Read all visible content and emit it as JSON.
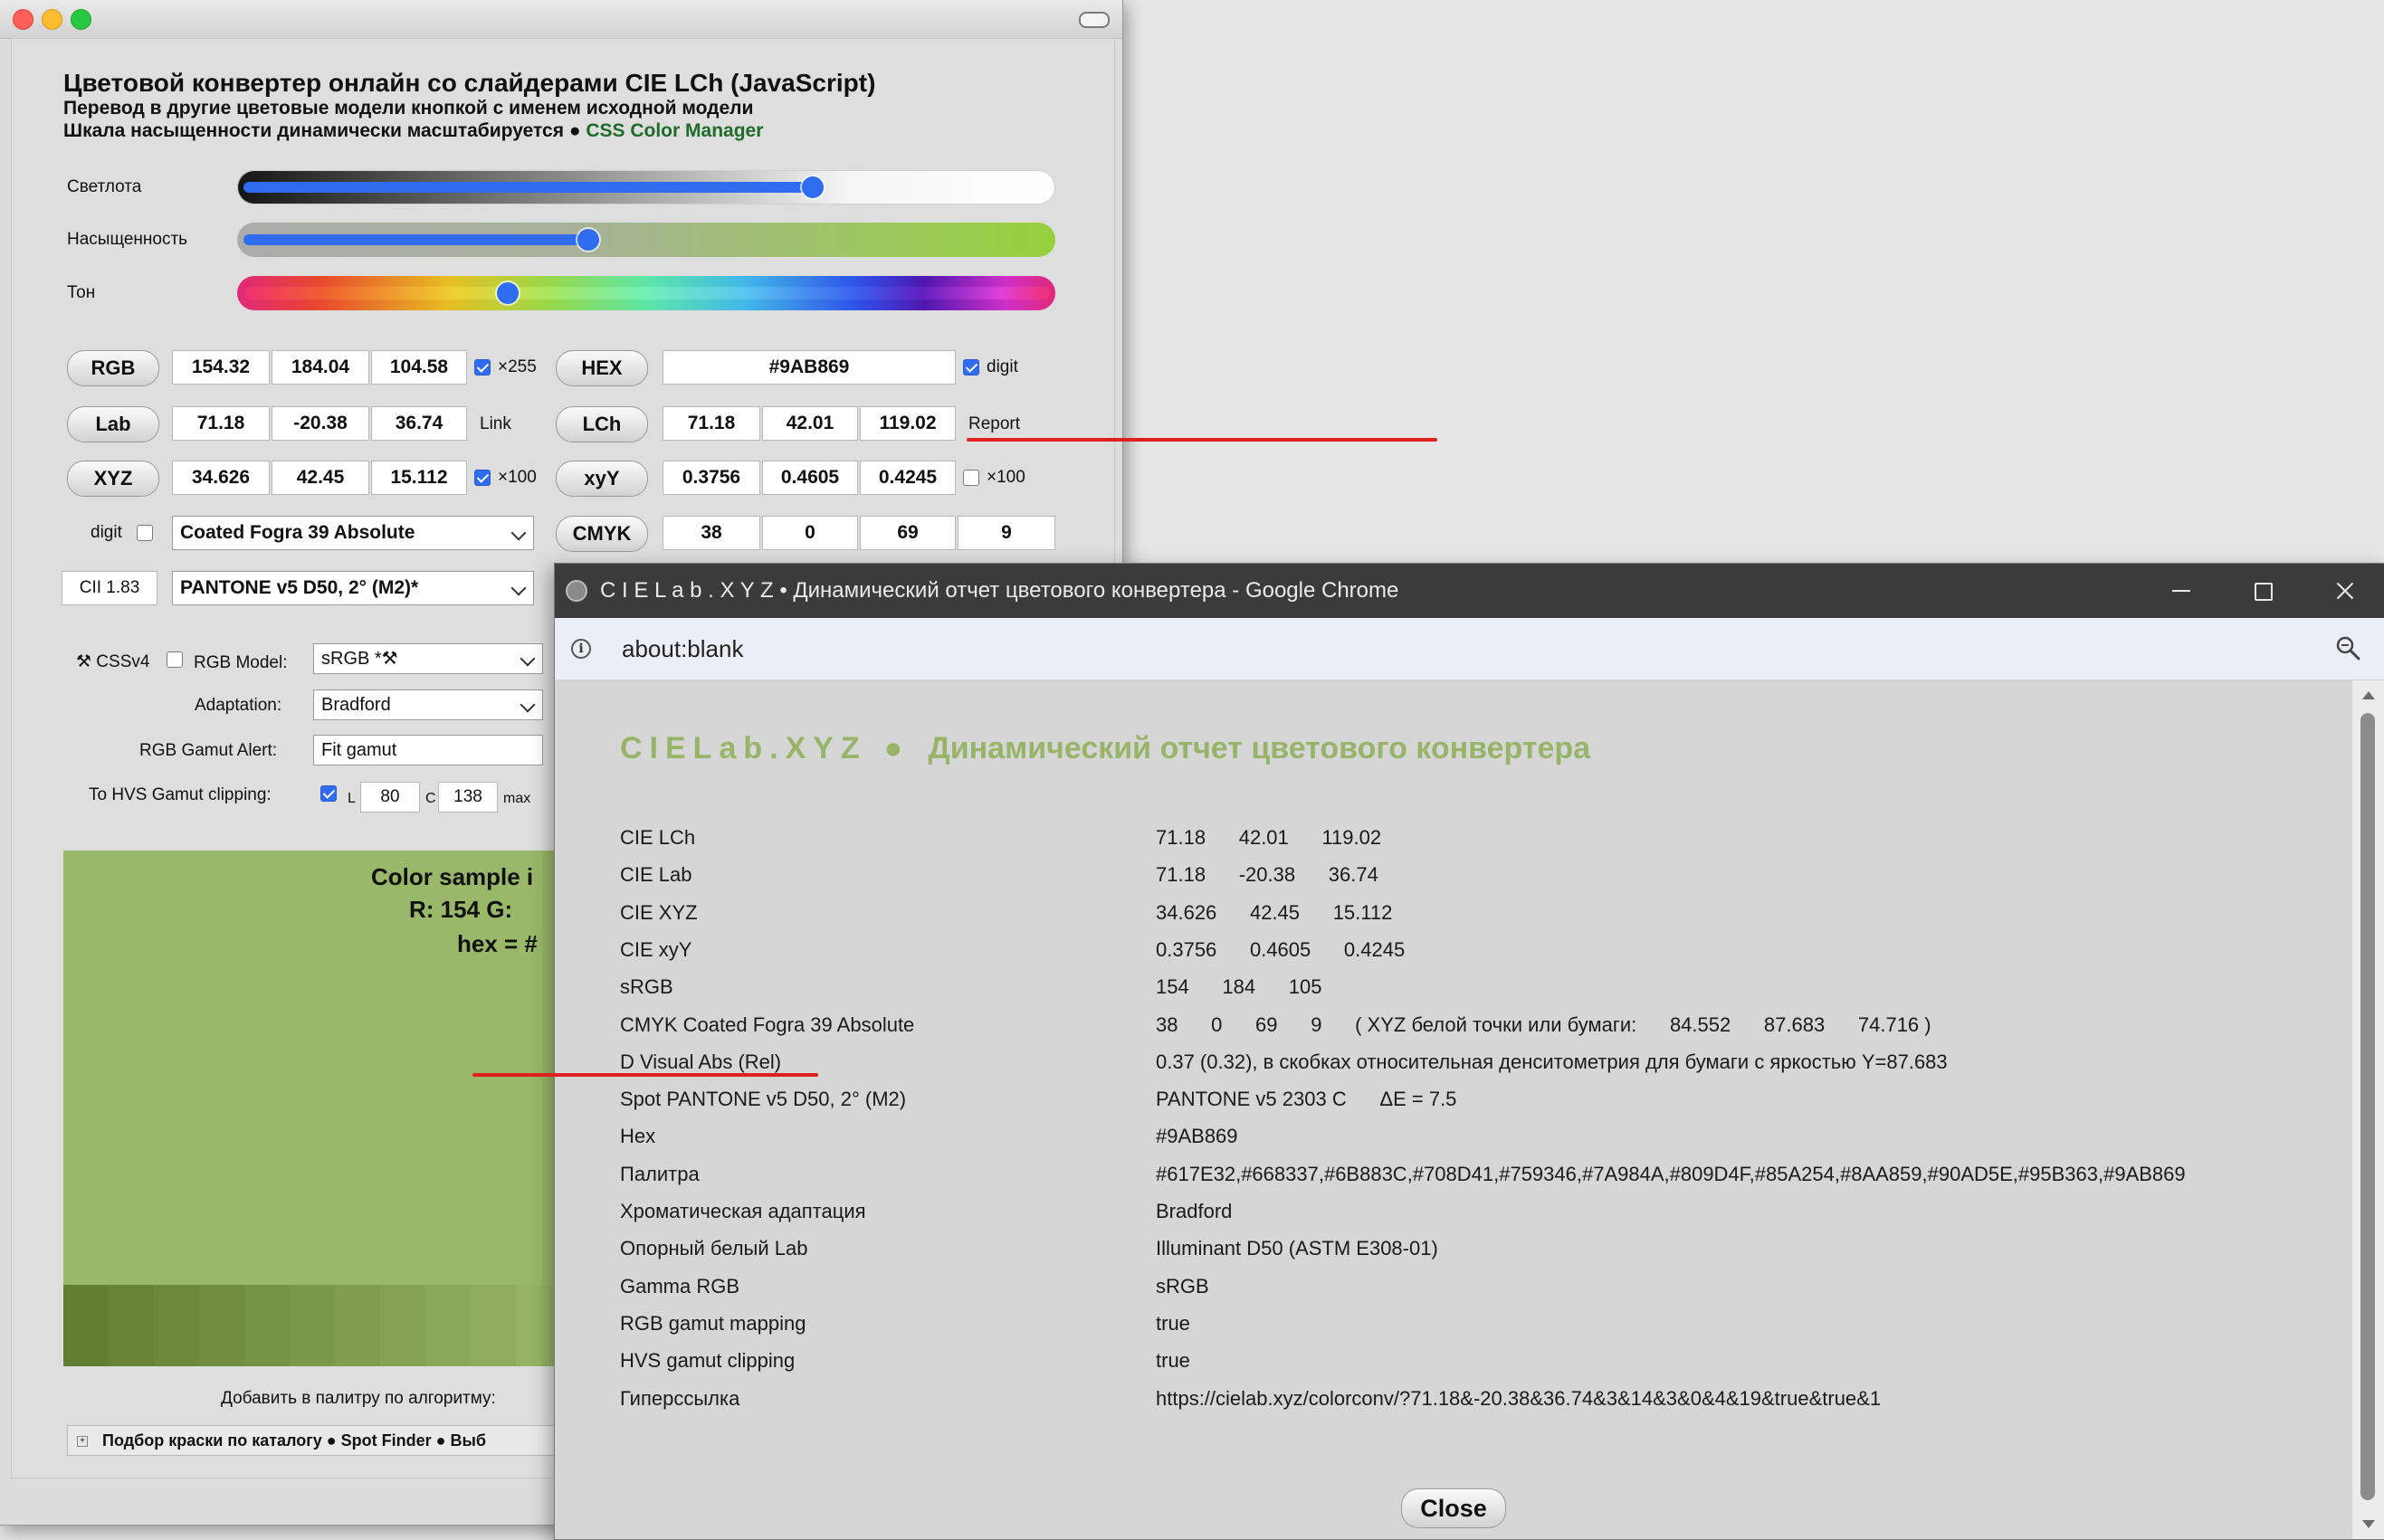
{
  "main": {
    "heading1": "Цветовой конвертер онлайн со слайдерами CIE LCh (JavaScript)",
    "heading2": "Перевод в другие цветовые модели кнопкой с именем исходной модели",
    "heading3_text": "Шкала насыщенности динамически масштабируется  ●  ",
    "heading3_link": "CSS Color Manager",
    "sliders": {
      "lightness": {
        "label": "Светлота",
        "value": 0.71
      },
      "chroma": {
        "label": "Насыщенность",
        "value": 0.43
      },
      "hue": {
        "label": "Тон",
        "value": 0.33
      }
    },
    "rows": {
      "rgb": {
        "button": "RGB",
        "v1": "154.32",
        "v2": "184.04",
        "v3": "104.58",
        "opt": "×255",
        "opt_checked": true
      },
      "hex": {
        "button": "HEX",
        "value": "#9AB869",
        "opt": "digit",
        "opt_checked": true
      },
      "lab": {
        "button": "Lab",
        "v1": "71.18",
        "v2": "-20.38",
        "v3": "36.74",
        "link": "Link"
      },
      "lch": {
        "button": "LCh",
        "v1": "71.18",
        "v2": "42.01",
        "v3": "119.02",
        "report": "Report"
      },
      "xyz": {
        "button": "XYZ",
        "v1": "34.626",
        "v2": "42.45",
        "v3": "15.112",
        "opt": "×100",
        "opt_checked": true
      },
      "xyy": {
        "button": "xyY",
        "v1": "0.3756",
        "v2": "0.4605",
        "v3": "0.4245",
        "opt": "×100",
        "opt_checked": false
      },
      "cmyk": {
        "digit_label": "digit",
        "profile": "Coated Fogra 39 Absolute",
        "button": "CMYK",
        "c": "38",
        "m": "0",
        "y": "69",
        "k": "9"
      },
      "spot": {
        "cii": "CII 1.83",
        "library": "PANTONE v5   D50, 2° (M2)*"
      }
    },
    "settings": {
      "cssv4_label": "⚒ CSSv4",
      "rgb_model_label": "RGB Model:",
      "rgb_model_value": "sRGB *⚒",
      "adaptation_label": "Adaptation:",
      "adaptation_value": "Bradford",
      "gamut_alert_label": "RGB Gamut Alert:",
      "gamut_alert_value": "Fit gamut",
      "hvs_label": "To HVS Gamut clipping:",
      "hvs_l_label": "L",
      "hvs_l_value": "80",
      "hvs_c_label": "C",
      "hvs_c_value": "138",
      "hvs_max": "max"
    },
    "sample": {
      "color": "#9AB869",
      "line1": "Color sample i",
      "line2": "R: 154   G:",
      "line3": "hex = #"
    },
    "palette": [
      "#617E32",
      "#668337",
      "#6B883C",
      "#708D41",
      "#759346",
      "#7A984A",
      "#809D4F",
      "#85A254",
      "#8AA859",
      "#90AD5E",
      "#95B363",
      "#9AB869"
    ],
    "add_palette": "Добавить в палитру по алгоритму:",
    "bottom_bar": "Подбор краски по каталогу ● Spot Finder ● Выб"
  },
  "report_window": {
    "title": "C I E L a b . X Y Z   •   Динамический отчет цветового конвертера - Google Chrome",
    "url": "about:blank",
    "heading_brand": "CIELab.XYZ",
    "heading_sep": "●",
    "heading_text": "Динамический отчет цветового конвертера",
    "rows": [
      {
        "key": "CIE LCh",
        "value": "71.18      42.01      119.02"
      },
      {
        "key": "CIE Lab",
        "value": "71.18      -20.38      36.74"
      },
      {
        "key": "CIE XYZ",
        "value": "34.626      42.45      15.112"
      },
      {
        "key": "CIE xyY",
        "value": "0.3756      0.4605      0.4245"
      },
      {
        "key": "sRGB",
        "value": "154      184      105"
      },
      {
        "key": "CMYK Coated Fogra 39 Absolute",
        "value": "38      0      69      9      ( XYZ белой точки или бумаги:      84.552      87.683      74.716 )"
      },
      {
        "key": "D Visual Abs (Rel)",
        "value": "0.37 (0.32), в скобках относительная денситометрия для бумаги с яркостью Y=87.683"
      },
      {
        "key": "Spot PANTONE v5 D50, 2° (M2)",
        "value": "PANTONE v5 2303 C      ΔE = 7.5"
      },
      {
        "key": "Hex",
        "value": "#9AB869"
      },
      {
        "key": "Палитра",
        "value": "#617E32,#668337,#6B883C,#708D41,#759346,#7A984A,#809D4F,#85A254,#8AA859,#90AD5E,#95B363,#9AB869"
      },
      {
        "key": "Хроматическая адаптация",
        "value": "Bradford"
      },
      {
        "key": "Опорный белый Lab",
        "value": "Illuminant D50 (ASTM E308-01)"
      },
      {
        "key": "Gamma RGB",
        "value": "sRGB"
      },
      {
        "key": "RGB gamut mapping",
        "value": "true"
      },
      {
        "key": "HVS gamut clipping",
        "value": "true"
      },
      {
        "key": "Гиперссылка",
        "value": "https://cielab.xyz/colorconv/?71.18&-20.38&36.74&3&14&3&0&4&19&true&true&1"
      }
    ],
    "close_label": "Close"
  },
  "colors": {
    "accent_blue": "#2f6cf0",
    "brand_green": "#98b468",
    "annotation_red": "#e02020"
  }
}
